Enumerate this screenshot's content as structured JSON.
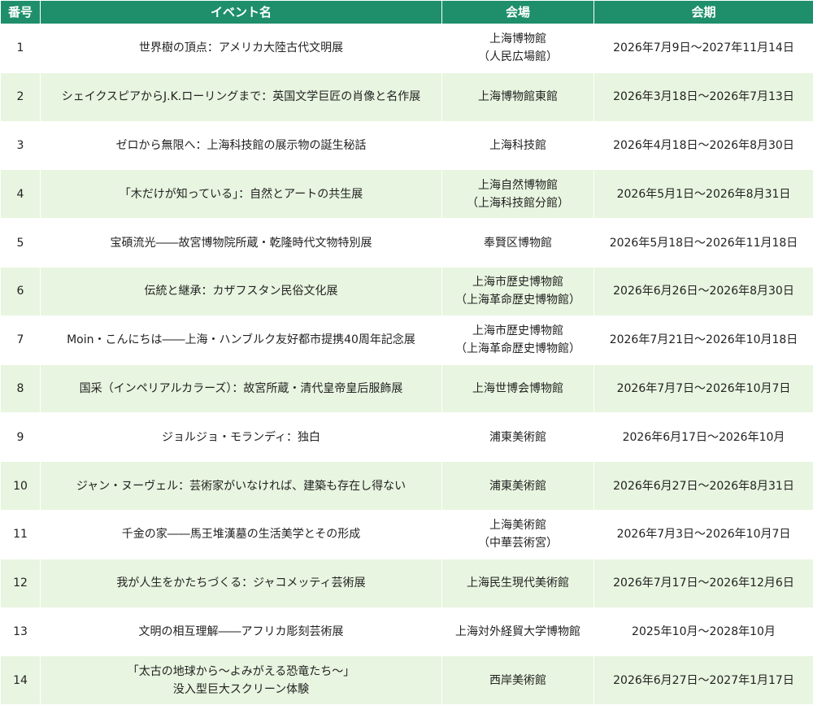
{
  "colors": {
    "header_bg": "#1e8f6a",
    "header_text": "#ffffff",
    "row_even_bg": "#e8f5e0",
    "row_odd_bg": "#ffffff"
  },
  "table": {
    "headers": {
      "no": "番号",
      "event": "イベント名",
      "venue": "会場",
      "period": "会期"
    },
    "rows": [
      {
        "no": "1",
        "event": [
          "世界樹の頂点：アメリカ大陸古代文明展"
        ],
        "venue": [
          "上海博物館",
          "（人民広場館）"
        ],
        "period": "2026年7月9日～2027年11月14日"
      },
      {
        "no": "2",
        "event": [
          "シェイクスピアからJ.K.ローリングまで：英国文学巨匠の肖像と名作展"
        ],
        "venue": [
          "上海博物館東館"
        ],
        "period": "2026年3月18日～2026年7月13日"
      },
      {
        "no": "3",
        "event": [
          "ゼロから無限へ：上海科技館の展示物の誕生秘話"
        ],
        "venue": [
          "上海科技館"
        ],
        "period": "2026年4月18日～2026年8月30日"
      },
      {
        "no": "4",
        "event": [
          "「木だけが知っている」：自然とアートの共生展"
        ],
        "venue": [
          "上海自然博物館",
          "（上海科技館分館）"
        ],
        "period": "2026年5月1日～2026年8月31日"
      },
      {
        "no": "5",
        "event": [
          "宝碩流光――故宮博物院所蔵・乾隆時代文物特別展"
        ],
        "venue": [
          "奉賢区博物館"
        ],
        "period": "2026年5月18日～2026年11月18日"
      },
      {
        "no": "6",
        "event": [
          "伝統と継承：カザフスタン民俗文化展"
        ],
        "venue": [
          "上海市歴史博物館",
          "（上海革命歴史博物館）"
        ],
        "period": "2026年6月26日～2026年8月30日"
      },
      {
        "no": "7",
        "event": [
          "Moin・こんにちは――上海・ハンブルク友好都市提携40周年記念展"
        ],
        "venue": [
          "上海市歴史博物館",
          "（上海革命歴史博物館）"
        ],
        "period": "2026年7月21日～2026年10月18日"
      },
      {
        "no": "8",
        "event": [
          "国采（インペリアルカラーズ）：故宮所蔵・清代皇帝皇后服飾展"
        ],
        "venue": [
          "上海世博会博物館"
        ],
        "period": "2026年7月7日～2026年10月7日"
      },
      {
        "no": "9",
        "event": [
          "ジョルジョ・モランディ：独白"
        ],
        "venue": [
          "浦東美術館"
        ],
        "period": "2026年6月17日～2026年10月"
      },
      {
        "no": "10",
        "event": [
          "ジャン・ヌーヴェル：芸術家がいなければ、建築も存在し得ない"
        ],
        "venue": [
          "浦東美術館"
        ],
        "period": "2026年6月27日～2026年8月31日"
      },
      {
        "no": "11",
        "event": [
          "千金の家――馬王堆漢墓の生活美学とその形成"
        ],
        "venue": [
          "上海美術館",
          "（中華芸術宮）"
        ],
        "period": "2026年7月3日～2026年10月7日"
      },
      {
        "no": "12",
        "event": [
          "我が人生をかたちづくる：ジャコメッティ芸術展"
        ],
        "venue": [
          "上海民生現代美術館"
        ],
        "period": "2026年7月17日～2026年12月6日"
      },
      {
        "no": "13",
        "event": [
          "文明の相互理解――アフリカ彫刻芸術展"
        ],
        "venue": [
          "上海対外経貿大学博物館"
        ],
        "period": "2025年10月～2028年10月"
      },
      {
        "no": "14",
        "event": [
          "「太古の地球から～よみがえる恐竜たち～」",
          "没入型巨大スクリーン体験"
        ],
        "venue": [
          "西岸美術館"
        ],
        "period": "2026年6月27日～2027年1月17日"
      }
    ]
  }
}
